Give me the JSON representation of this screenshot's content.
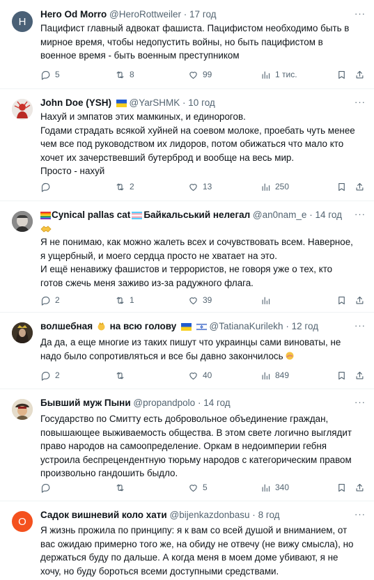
{
  "tweets": [
    {
      "name": "Hero Od Morro",
      "handle": "@HeroRottweiler",
      "dot": "·",
      "time": "17 год",
      "avatar_letter": "H",
      "avatar_color": "#4a6076",
      "lines": [
        "Пацифист главный адвокат фашиста. Пацифистом необходимо быть в",
        "мирное время, чтобы недопустить войны, но быть пацифистом в",
        "военное время - быть военным преступником"
      ],
      "replies": "5",
      "reposts": "8",
      "likes": "99",
      "views": "1 тис."
    },
    {
      "name": "John Doe (YSH)",
      "handle": "@YarSHMK",
      "dot": "·",
      "time": "10 год",
      "lines": [
        "Нахуй и эмпатов этих мамкиных, и единорогов.",
        "Годами страдать всякой хуйней на соевом молоке, проебать чуть менее",
        "чем все под руководством их лидоров, потом обижаться что мало кто",
        "хочет их зачерствевший бутерброд и вообще на весь мир.",
        "Просто - нахуй"
      ],
      "replies": "",
      "reposts": "2",
      "likes": "13",
      "views": "250"
    },
    {
      "name": "Cynical pallas cat",
      "name2": "Байкальський нелегал",
      "handle": "@an0nam_e",
      "dot": "·",
      "time": "14 год",
      "lines": [
        "Я не понимаю, как можно жалеть всех и сочувствовать всем. Наверное,",
        "я ущербный, и моего сердца просто не хватает на это.",
        "И ещё ненавижу фашистов и террористов, не говоря уже о тех, кто",
        "готов сжечь меня заживо из-за радужного флага."
      ],
      "replies": "2",
      "reposts": "1",
      "likes": "39",
      "views": ""
    },
    {
      "name": "волшебная",
      "name2": "на всю голову",
      "handle": "@TatianaKurilekh",
      "dot": "·",
      "time": "12 год",
      "lines": [
        "Да да, а еще многие из таких пишут что украинцы сами виноваты, не",
        "надо было сопротивляться и все бы давно закончилось"
      ],
      "replies": "2",
      "reposts": "",
      "likes": "40",
      "views": "849"
    },
    {
      "name": "Бывший муж Пыни",
      "handle": "@propandpolo",
      "dot": "·",
      "time": "14 год",
      "lines": [
        "Государство по Смитту есть добровольное объединение граждан,",
        "повышающее выживаемость общества. В этом свете логично выглядит",
        "право народов на самоопределение. Оркам в недоимперии гебня",
        "устроила беспрецендентную тюрьму народов с категорическим правом",
        "произвольно гандошить быдло."
      ],
      "replies": "",
      "reposts": "",
      "likes": "5",
      "views": "340"
    },
    {
      "name": "Садок вишневий коло хати",
      "handle": "@bijenkazdonbasu",
      "dot": "·",
      "time": "8 год",
      "avatar_letter": "O",
      "avatar_color": "#f4511e",
      "lines": [
        "Я жизнь прожила по принципу: я к вам со всей душой и вниманием, от",
        "вас ожидаю примерно того же, на обиду не отвечу (не вижу смысла), но",
        "держаться буду по дальше. А когда меня в моем доме убивают, я не",
        "хочу, но буду бороться всеми доступными средствами."
      ],
      "replies": "",
      "reposts": "",
      "likes": "",
      "views": ""
    }
  ]
}
